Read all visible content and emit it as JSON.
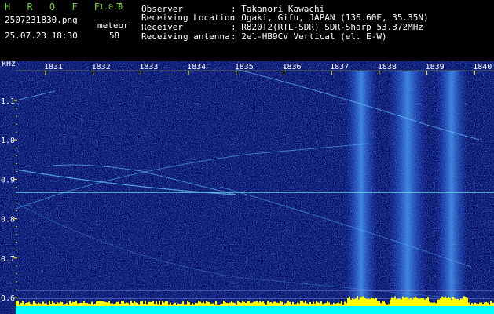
{
  "header": {
    "app_name": "H R O F F T",
    "version": "1.0.0",
    "filename": "2507231830.png",
    "datetime": "25.07.23 18:30",
    "meteor_label": "meteor",
    "meteor_count": "58",
    "info_rows": [
      {
        "label": "Observer",
        "value": ": Takanori Kawachi"
      },
      {
        "label": "Receiving Location",
        "value": ": Ogaki, Gifu, JAPAN (136.60E, 35.35N)"
      },
      {
        "label": "Receiver",
        "value": ": R820T2(RTL-SDR) SDR-Sharp 53.372MHz"
      },
      {
        "label": "Receiving antenna",
        "value": ": 2el-HB9CV Vertical (el. E-W)"
      }
    ]
  },
  "spectrogram": {
    "unit_label": "kHz",
    "time_ticks": [
      "1831",
      "1832",
      "1833",
      "1834",
      "1835",
      "1836",
      "1837",
      "1838",
      "1839",
      "1840"
    ],
    "freq_ticks": [
      "1.1",
      "1.0",
      "0.9",
      "0.8",
      "0.7",
      "0.6"
    ],
    "colors": {
      "background": "#050b5e",
      "noise": "#1a3bd8",
      "bright": "#7fe0ff",
      "tick": "#ffff00",
      "level": "#00ffff"
    }
  }
}
